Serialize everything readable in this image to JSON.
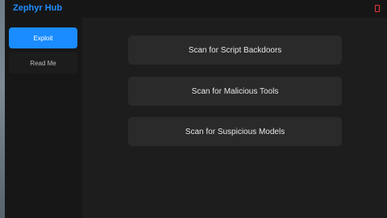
{
  "window": {
    "title": "Zephyr Hub",
    "accent_color": "#1a8cff",
    "close_icon": "close-icon"
  },
  "sidebar": {
    "items": [
      {
        "label": "Exploit",
        "active": true
      },
      {
        "label": "Read Me",
        "active": false
      }
    ]
  },
  "main": {
    "buttons": [
      {
        "label": "Scan for Script Backdoors"
      },
      {
        "label": "Scan for Malicious Tools"
      },
      {
        "label": "Scan for Suspicious Models"
      }
    ]
  }
}
